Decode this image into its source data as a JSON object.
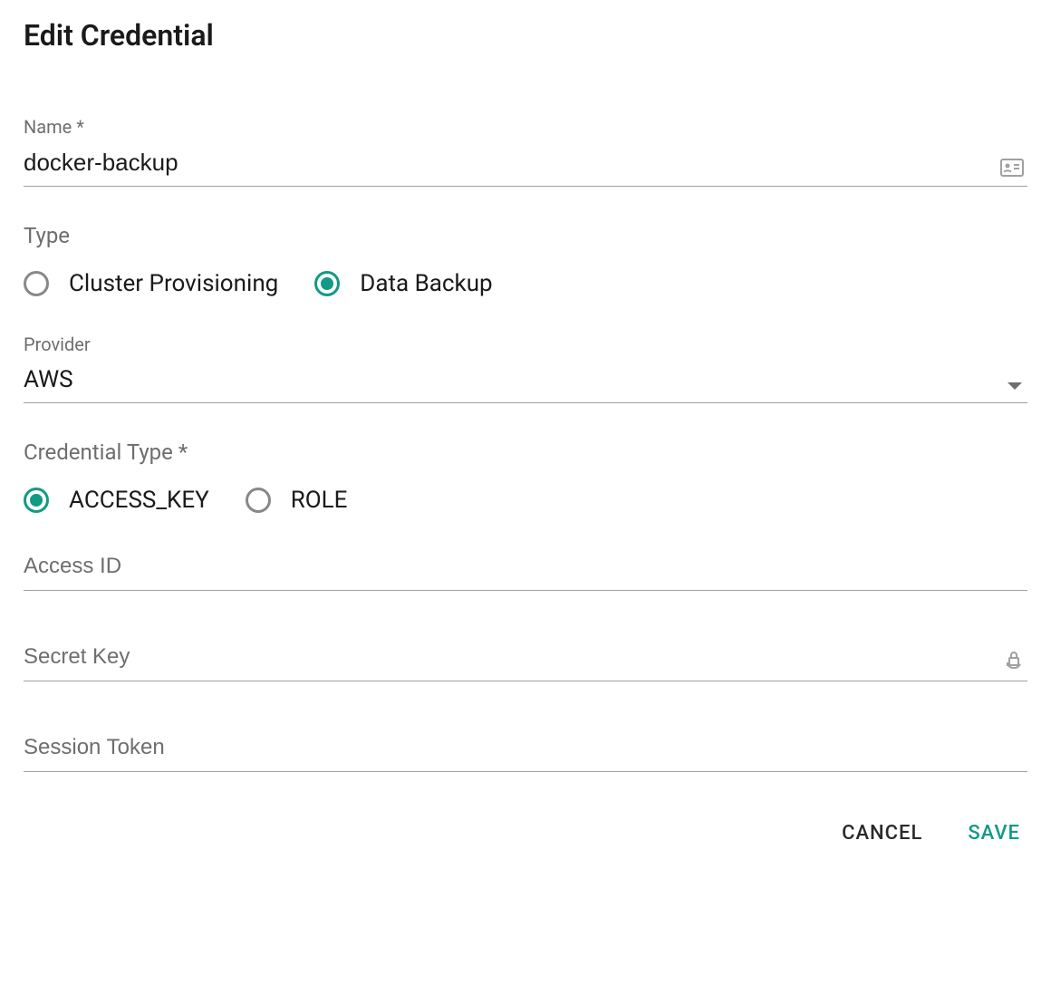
{
  "dialog": {
    "title": "Edit Credential",
    "fields": {
      "name": {
        "label": "Name *",
        "value": "docker-backup"
      },
      "type": {
        "label": "Type",
        "options": {
          "clusterProvisioning": "Cluster Provisioning",
          "dataBackup": "Data Backup"
        },
        "selected": "dataBackup"
      },
      "provider": {
        "label": "Provider",
        "value": "AWS"
      },
      "credentialType": {
        "label": "Credential Type *",
        "options": {
          "accessKey": "ACCESS_KEY",
          "role": "ROLE"
        },
        "selected": "accessKey"
      },
      "accessId": {
        "placeholder": "Access ID",
        "value": ""
      },
      "secretKey": {
        "placeholder": "Secret Key",
        "value": ""
      },
      "sessionToken": {
        "placeholder": "Session Token",
        "value": ""
      }
    },
    "buttons": {
      "cancel": "CANCEL",
      "save": "SAVE"
    }
  }
}
